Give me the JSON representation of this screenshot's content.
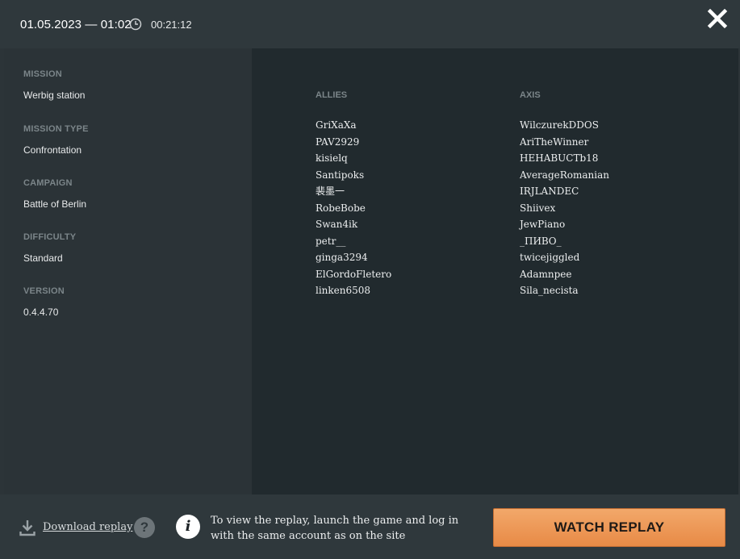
{
  "header": {
    "date": "01.05.2023 — 01:02",
    "clock_icon": "clock-icon",
    "duration": "00:21:12",
    "close_icon": "close-icon"
  },
  "details": {
    "mission_label": "MISSION",
    "mission_value": "Werbig station",
    "mission_type_label": "MISSION TYPE",
    "mission_type_value": "Confrontation",
    "campaign_label": "CAMPAIGN",
    "campaign_value": "Battle of Berlin",
    "difficulty_label": "DIFFICULTY",
    "difficulty_value": "Standard",
    "version_label": "VERSION",
    "version_value": "0.4.4.70"
  },
  "teams": {
    "allies": {
      "title": "ALLIES",
      "players": [
        "GriXaXa",
        "PAV2929",
        "kisielq",
        "Santipoks",
        "裴墨一",
        "RobeBobe",
        "Swan4ik",
        "petr__",
        "ginga3294",
        "ElGordoFletero",
        "linken6508"
      ]
    },
    "axis": {
      "title": "AXIS",
      "players": [
        "WilczurekDDOS",
        "AriTheWinner",
        "HEHABUCTb18",
        "AverageRomanian",
        "IRJLANDEC",
        "Shiivex",
        "JewPiano",
        "_ПИВО_",
        "twicejiggled",
        "Adamnpee",
        "Sila_necista"
      ]
    }
  },
  "footer": {
    "download_label": "Download replay",
    "download_icon": "download-icon",
    "help_icon": "help-icon",
    "help_glyph": "?",
    "info_icon": "info-icon",
    "info_glyph": "i",
    "info_text": "To view the replay, launch the game and log in with the same account as on the site",
    "watch_button": "WATCH REPLAY"
  },
  "colors": {
    "accent": "#e88a46",
    "panel_dark": "#212a2e",
    "panel": "#2c3438"
  }
}
